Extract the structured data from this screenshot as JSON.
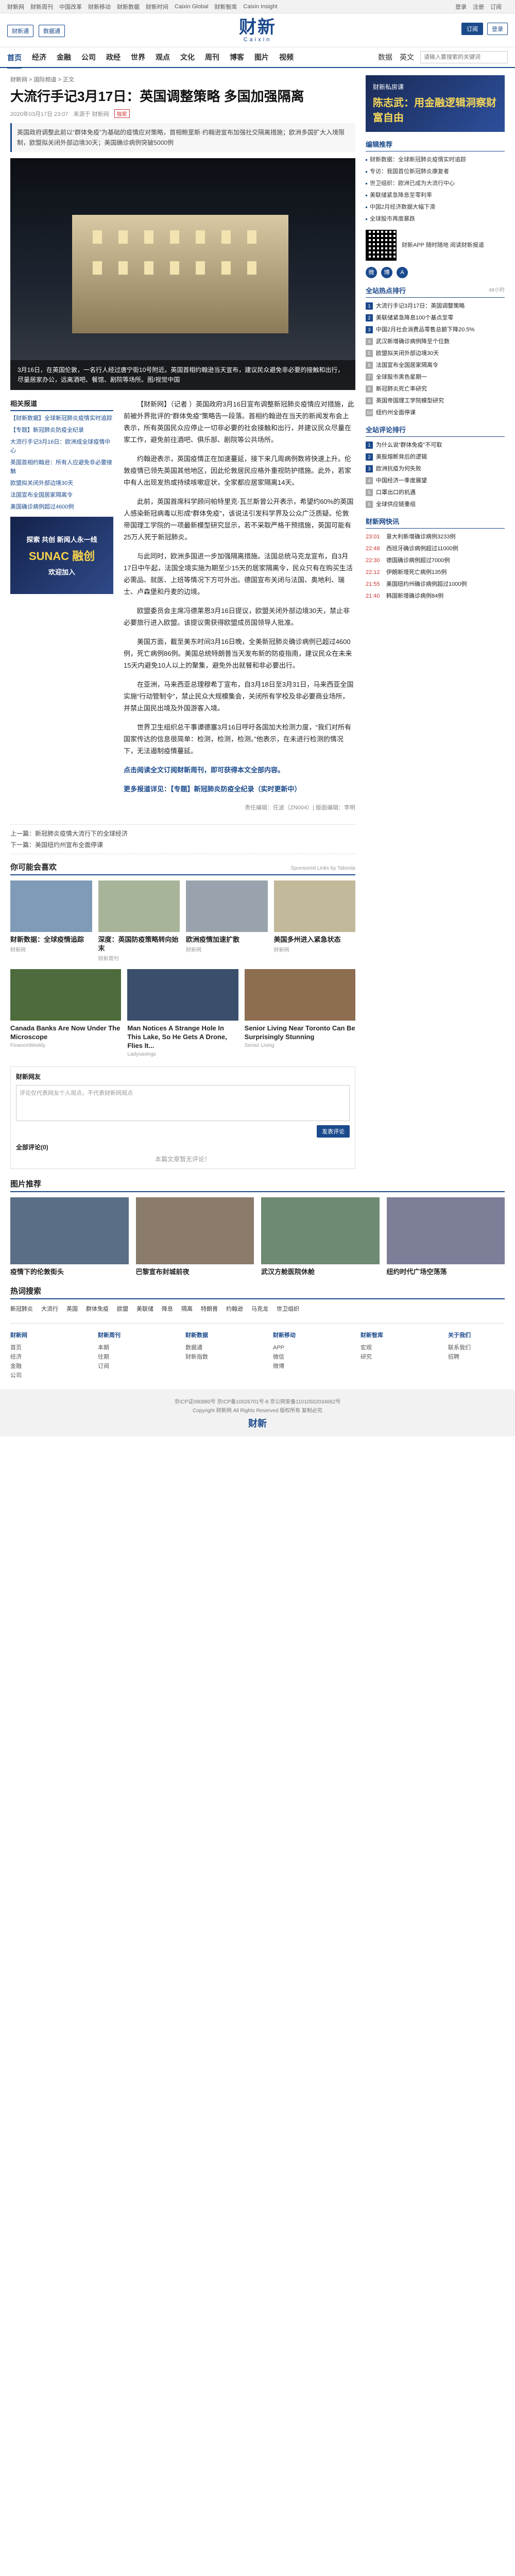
{
  "topbar": {
    "links": [
      "财新网",
      "财新周刊",
      "中国改革",
      "财新移动",
      "财新数据",
      "财新时间",
      "Caixin Global",
      "财新智库",
      "Caixin Insight"
    ],
    "right": [
      "登录",
      "注册",
      "订阅"
    ]
  },
  "masthead": {
    "logo_cn": "财新",
    "logo_en": "Caixin",
    "left": [
      "财新通",
      "数据通"
    ],
    "subscribe": "订阅",
    "login": "登录"
  },
  "nav": {
    "items": [
      "首页",
      "经济",
      "金融",
      "公司",
      "政经",
      "世界",
      "观点",
      "文化",
      "周刊",
      "博客",
      "图片",
      "视频"
    ],
    "active": "首页",
    "right": [
      "数据",
      "英文"
    ],
    "search_placeholder": "请输入要搜索的关键词"
  },
  "article": {
    "breadcrumb": "财新网 > 国际频道 > 正文",
    "title": "大流行手记3月17日：英国调整策略 多国加强隔离",
    "meta_time": "2020年03月17日 23:07",
    "meta_source": "来源于 财新网",
    "meta_badge": "独家",
    "summary": "英国政府调整此前以“群体免疫”为基础的疫情应对策略，首相鲍里斯·约翰逊宣布加强社交隔离措施；欧洲多国扩大入境限制，欧盟拟关闭外部边境30天；美国确诊病例突破5000例",
    "hero_caption": "3月16日，在英国伦敦，一名行人经过唐宁街10号附近。英国首相约翰逊当天宣布，建议民众避免非必要的接触和出行，尽量居家办公，远离酒吧、餐馆、剧院等场所。图/视觉中国",
    "paragraphs": [
      "【财新网】（记者 ）英国政府3月16日宣布调整新冠肺炎疫情应对措施，此前被外界批评的“群体免疫”策略告一段落。首相约翰逊在当天的新闻发布会上表示，所有英国民众应停止一切非必要的社会接触和出行，并建议民众尽量在家工作，避免前往酒吧、俱乐部、剧院等公共场所。",
      "约翰逊表示，英国疫情正在加速蔓延，接下来几周病例数将快速上升。伦敦疫情已领先英国其他地区，因此伦敦居民应格外重视防护措施。此外，若家中有人出现发热或持续咳嗽症状，全家都应居家隔离14天。",
      "此前，英国首席科学顾问帕特里克·瓦兰斯曾公开表示，希望约60%的英国人感染新冠病毒以形成“群体免疫”，该说法引发科学界及公众广泛质疑。伦敦帝国理工学院的一项最新模型研究显示，若不采取严格干预措施，英国可能有25万人死于新冠肺炎。",
      "与此同时，欧洲多国进一步加强隔离措施。法国总统马克龙宣布，自3月17日中午起，法国全境实施为期至少15天的居家隔离令，民众只有在购买生活必需品、就医、上班等情况下方可外出。德国宣布关闭与法国、奥地利、瑞士、卢森堡和丹麦的边境。",
      "欧盟委员会主席冯德莱恩3月16日提议，欧盟关闭外部边境30天，禁止非必要旅行进入欧盟。该提议需获得欧盟成员国领导人批准。",
      "美国方面，截至美东时间3月16日晚，全美新冠肺炎确诊病例已超过4600例，死亡病例86例。美国总统特朗普当天发布新的防疫指南，建议民众在未来15天内避免10人以上的聚集，避免外出就餐和非必要出行。",
      "在亚洲，马来西亚总理穆希丁宣布，自3月18日至3月31日，马来西亚全国实施“行动管制令”，禁止民众大规模集会，关闭所有学校及非必要商业场所，并禁止国民出境及外国游客入境。",
      "世界卫生组织总干事谭德塞3月16日呼吁各国加大检测力度，“我们对所有国家传达的信息很简单：检测，检测，检测。”他表示，在未进行检测的情况下，无法遏制疫情蔓延。",
      "点击阅读全文订阅财新周刊，即可获得本文全部内容。"
    ],
    "highlight": "更多报道详见：【专题】新冠肺炎防疫全纪录（实时更新中）",
    "editor": "责任编辑：任波（ZN004）| 版面编辑：李明",
    "prev": "上一篇：新冠肺炎疫情大流行下的全球经济",
    "next": "下一篇：美国纽约州宣布全面停课"
  },
  "left_related": {
    "header": "相关报道",
    "items": [
      "【财新数据】全球新冠肺炎疫情实时追踪",
      "【专题】新冠肺炎防疫全纪录",
      "大流行手记3月16日：欧洲成全球疫情中心",
      "英国首相约翰逊：所有人应避免非必要接触",
      "欧盟拟关闭外部边境30天",
      "法国宣布全国居家隔离令",
      "美国确诊病例超过4600例"
    ],
    "ad_line1": "探索 共创 新闻人永一线",
    "ad_line2": "SUNAC 融创",
    "ad_line3": "欢迎加入"
  },
  "recommend": {
    "header": "你可能会喜欢",
    "note": "Sponsored Links by Taboola",
    "cards": [
      {
        "title": "财新数据：全球疫情追踪",
        "source": "财新网"
      },
      {
        "title": "深度：英国防疫策略转向始末",
        "source": "财新周刊"
      },
      {
        "title": "欧洲疫情加速扩散",
        "source": "财新网"
      },
      {
        "title": "美国多州进入紧急状态",
        "source": "财新网"
      }
    ],
    "row2": [
      {
        "title": "Canada Banks Are Now Under The Microscope",
        "source": "FinanceWeekly"
      },
      {
        "title": "Man Notices A Strange Hole In This Lake, So He Gets A Drone, Flies It...",
        "source": "Ladysavings"
      },
      {
        "title": "Senior Living Near Toronto Can Be Surprisingly Stunning",
        "source": "Senior Living"
      }
    ]
  },
  "comment": {
    "header": "财新网友",
    "placeholder": "评论仅代表网友个人观点，不代表财新网观点",
    "submit": "发表评论",
    "count_label": "全部评论(0)",
    "empty": "本篇文章暂无评论！"
  },
  "side": {
    "ad_line1": "财新私房课",
    "ad_line2": "陈志武：用金融逻辑洞察财富自由",
    "edit_header": "编辑推荐",
    "edit_items": [
      "财新数据：全球新冠肺炎疫情实时追踪",
      "专访：我国首位新冠肺炎康复者",
      "世卫组织：欧洲已成为大流行中心",
      "美联储紧急降息至零利率",
      "中国2月经济数据大幅下滑",
      "全球股市再度暴跌"
    ],
    "promo_text": "财新APP 随时随地 阅读财新报道",
    "rank_header": "全站热点排行",
    "rank_more": "48小时",
    "rank_items": [
      "大流行手记3月17日：英国调整策略",
      "美联储紧急降息100个基点至零",
      "中国2月社会消费品零售总额下降20.5%",
      "武汉新增确诊病例降至个位数",
      "欧盟拟关闭外部边境30天",
      "法国宣布全国居家隔离令",
      "全球股市黑色星期一",
      "新冠肺炎死亡率研究",
      "英国帝国理工学院模型研究",
      "纽约州全面停课"
    ],
    "rank2_header": "全站评论排行",
    "rank2_items": [
      "为什么说“群体免疫”不可取",
      "美股熔断背后的逻辑",
      "欧洲抗疫为何失败",
      "中国经济一季度展望",
      "口罩出口的机遇",
      "全球供应链重组"
    ],
    "time_header": "财新网快讯",
    "time_items": [
      {
        "tm": "23:01",
        "t": "意大利新增确诊病例3233例"
      },
      {
        "tm": "22:48",
        "t": "西班牙确诊病例超过11000例"
      },
      {
        "tm": "22:30",
        "t": "德国确诊病例超过7000例"
      },
      {
        "tm": "22:12",
        "t": "伊朗新增死亡病例135例"
      },
      {
        "tm": "21:55",
        "t": "美国纽约州确诊病例超过1000例"
      },
      {
        "tm": "21:40",
        "t": "韩国新增确诊病例84例"
      }
    ]
  },
  "photo": {
    "header": "图片推荐",
    "cards": [
      {
        "title": "疫情下的伦敦街头"
      },
      {
        "title": "巴黎宣布封城前夜"
      },
      {
        "title": "武汉方舱医院休舱"
      },
      {
        "title": "纽约时代广场空荡荡"
      }
    ]
  },
  "hotwords": {
    "header": "热词搜索",
    "items": [
      "新冠肺炎",
      "大流行",
      "英国",
      "群体免疫",
      "欧盟",
      "美联储",
      "降息",
      "隔离",
      "特朗普",
      "约翰逊",
      "马克龙",
      "世卫组织"
    ]
  },
  "sitemap": {
    "header": "网站导航",
    "cols": [
      {
        "h": "财新网",
        "items": [
          "首页",
          "经济",
          "金融",
          "公司"
        ]
      },
      {
        "h": "财新周刊",
        "items": [
          "本期",
          "往期",
          "订阅"
        ]
      },
      {
        "h": "财新数据",
        "items": [
          "数据通",
          "财新指数"
        ]
      },
      {
        "h": "财新移动",
        "items": [
          "APP",
          "微信",
          "微博"
        ]
      },
      {
        "h": "财新智库",
        "items": [
          "宏观",
          "研究"
        ]
      },
      {
        "h": "关于我们",
        "items": [
          "联系我们",
          "招聘"
        ]
      }
    ]
  },
  "footer": {
    "line1": "京ICP证090880号 京ICP备10026701号-8 京公网安备11010502034662号",
    "line2": "Copyright 财新网 All Rights Reserved 版权所有 复制必究",
    "logo": "财新"
  }
}
